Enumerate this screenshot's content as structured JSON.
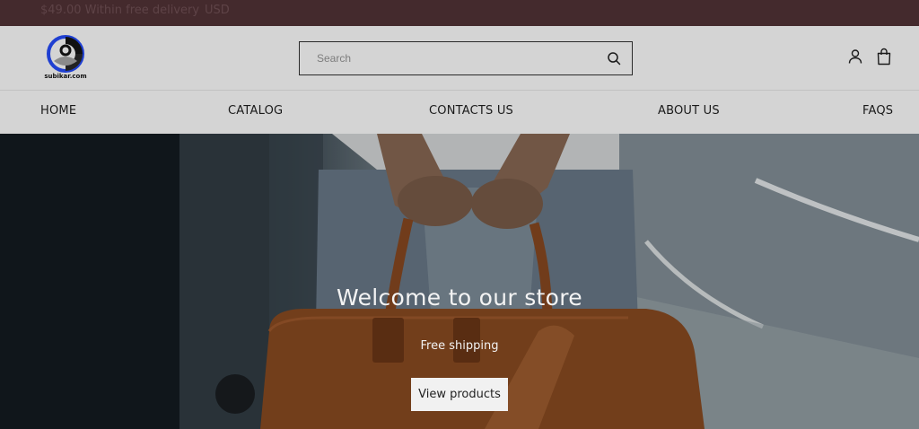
{
  "announcement": {
    "message": "$49.00 Within free delivery",
    "currency": "USD"
  },
  "header": {
    "logo_text": "subikar.com",
    "search": {
      "placeholder": "Search"
    },
    "icons": {
      "search": "search-icon",
      "account": "account-icon",
      "cart": "shopping-bag-icon"
    }
  },
  "nav": {
    "items": [
      {
        "label": "HOME"
      },
      {
        "label": "CATALOG"
      },
      {
        "label": "CONTACTS US"
      },
      {
        "label": "ABOUT US"
      },
      {
        "label": "FAQS"
      }
    ]
  },
  "hero": {
    "title": "Welcome to our store",
    "subtitle": "Free shipping",
    "button_label": "View products"
  },
  "colors": {
    "announcement_bg": "#442a2d",
    "header_bg": "#d4d4d4",
    "hero_text": "#f3f3f3",
    "button_bg": "#f1f1f1"
  }
}
